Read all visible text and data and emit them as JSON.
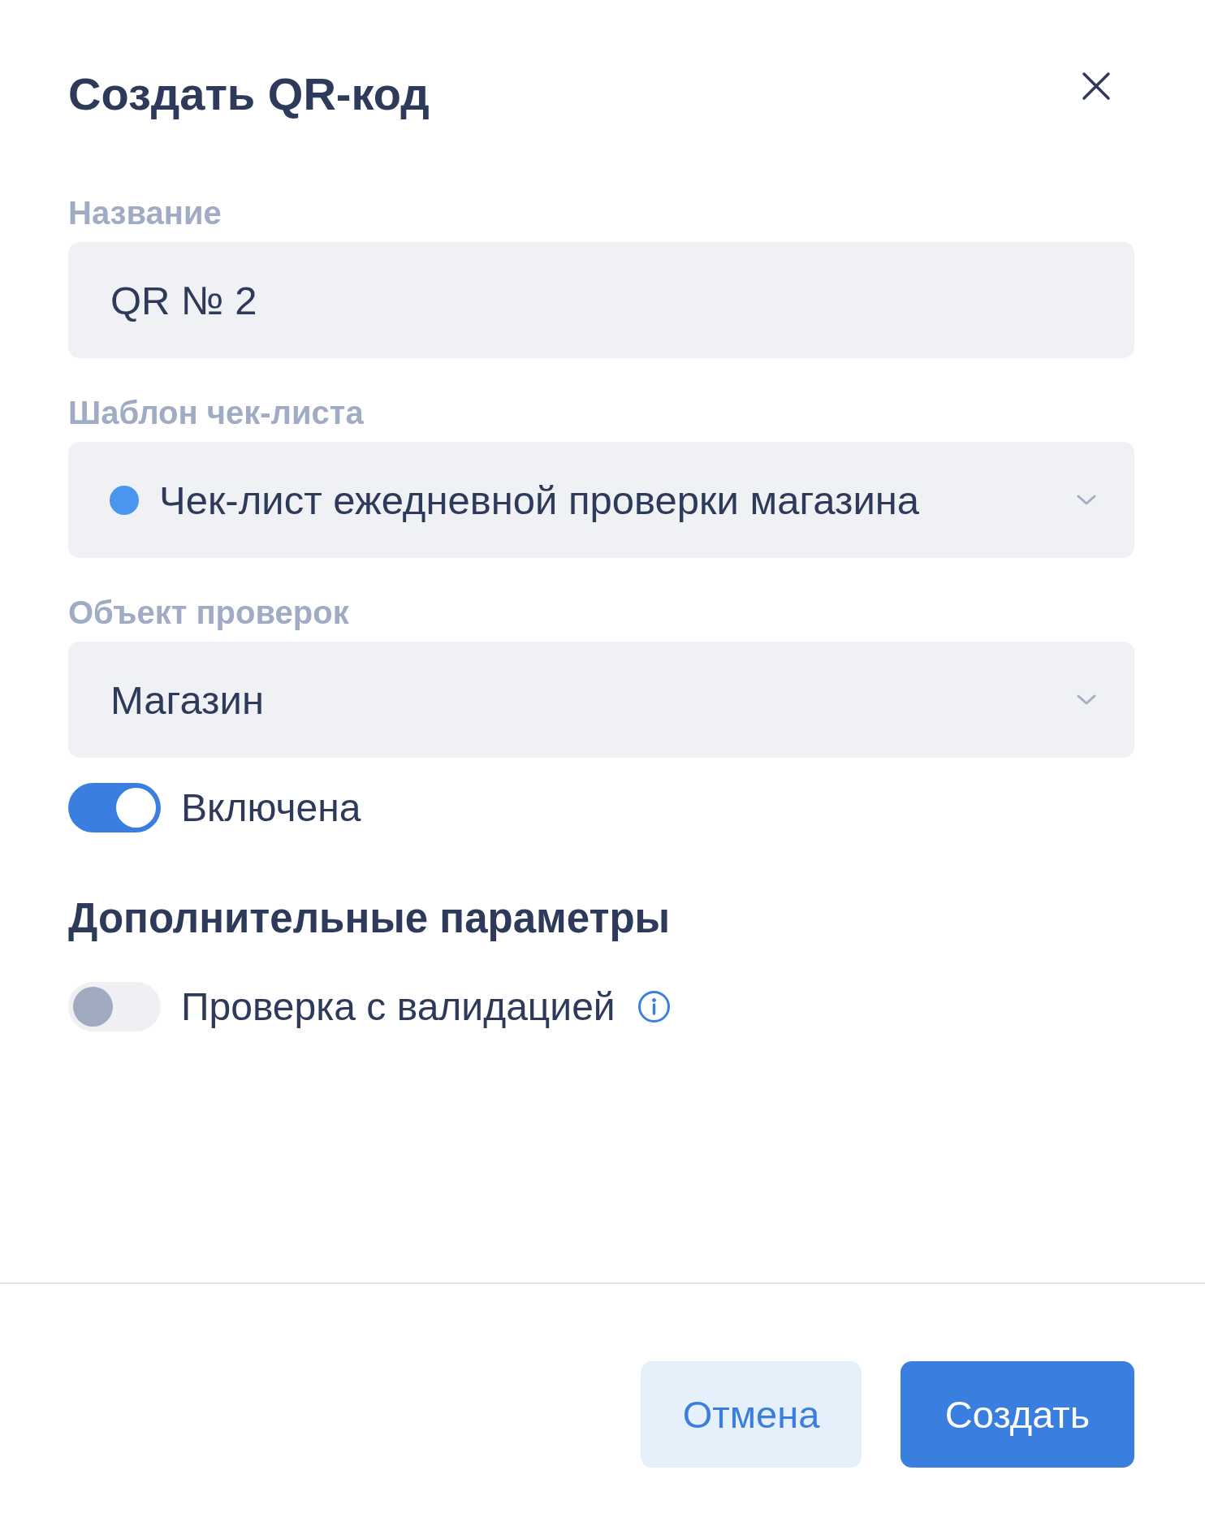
{
  "dialog": {
    "title": "Создать QR-код"
  },
  "fields": [
    {
      "kind": "text",
      "label": "Название",
      "value": "QR № 2"
    },
    {
      "kind": "select",
      "label": "Шаблон чек-листа",
      "value": "Чек-лист ежедневной проверки магазина",
      "color": "#4a96ee"
    },
    {
      "kind": "select",
      "label": "Объект проверок",
      "value": "Магазин"
    }
  ],
  "status_toggle": {
    "label": "Включена",
    "on": true
  },
  "additional": {
    "heading": "Дополнительные параметры",
    "toggles": [
      {
        "label": "Проверка с валидацией",
        "on": false,
        "info": true
      }
    ]
  },
  "buttons": [
    {
      "kind": "cancel",
      "label": "Отмена"
    },
    {
      "kind": "submit",
      "label": "Создать"
    }
  ]
}
